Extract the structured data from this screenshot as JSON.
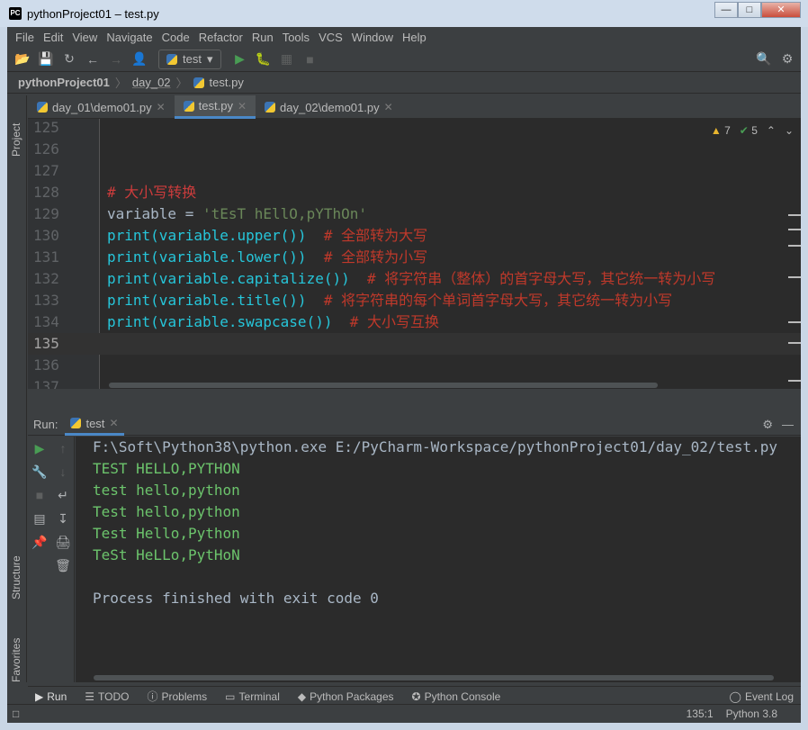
{
  "window": {
    "title": "pythonProject01 – test.py"
  },
  "menu": [
    "File",
    "Edit",
    "View",
    "Navigate",
    "Code",
    "Refactor",
    "Run",
    "Tools",
    "VCS",
    "Window",
    "Help"
  ],
  "toolbar": {
    "run_config": "test"
  },
  "breadcrumb": {
    "project": "pythonProject01",
    "folder": "day_02",
    "file": "test.py"
  },
  "sidebar": {
    "project": "Project",
    "structure": "Structure",
    "favorites": "Favorites"
  },
  "tabs": [
    {
      "label": "day_01\\demo01.py"
    },
    {
      "label": "test.py"
    },
    {
      "label": "day_02\\demo01.py"
    }
  ],
  "inspection": {
    "warnings": "7",
    "ok": "5"
  },
  "editor": {
    "lines": [
      {
        "num": "125"
      },
      {
        "num": "126"
      },
      {
        "num": "127"
      },
      {
        "num": "128",
        "comment": "# 大小写转换"
      },
      {
        "num": "129",
        "var": "variable",
        "op": " = ",
        "str": "'tEsT hEllO,pYThOn'"
      },
      {
        "num": "130",
        "fn": "print",
        "body": "(variable.upper())",
        "comment": "  # 全部转为大写"
      },
      {
        "num": "131",
        "fn": "print",
        "body": "(variable.lower())",
        "comment": "  # 全部转为小写"
      },
      {
        "num": "132",
        "fn": "print",
        "body": "(variable.capitalize())",
        "comment": "  # 将字符串（整体）的首字母大写，其它统一转为小写"
      },
      {
        "num": "133",
        "fn": "print",
        "body": "(variable.title())",
        "comment": "  # 将字符串的每个单词首字母大写，其它统一转为小写"
      },
      {
        "num": "134",
        "fn": "print",
        "body": "(variable.swapcase())",
        "comment": "  # 大小写互换"
      },
      {
        "num": "135"
      },
      {
        "num": "136"
      },
      {
        "num": "137"
      }
    ]
  },
  "run": {
    "label": "Run:",
    "tab": "test",
    "output": [
      "F:\\Soft\\Python38\\python.exe E:/PyCharm-Workspace/pythonProject01/day_02/test.py",
      "TEST HELLO,PYTHON",
      "test hello,python",
      "Test hello,python",
      "Test Hello,Python",
      "TeSt HeLLo,PytHoN",
      "",
      "Process finished with exit code 0"
    ]
  },
  "bottom_tools": [
    "Run",
    "TODO",
    "Problems",
    "Terminal",
    "Python Packages",
    "Python Console"
  ],
  "event_log": "Event Log",
  "status": {
    "position": "135:1",
    "interpreter": "Python 3.8"
  }
}
